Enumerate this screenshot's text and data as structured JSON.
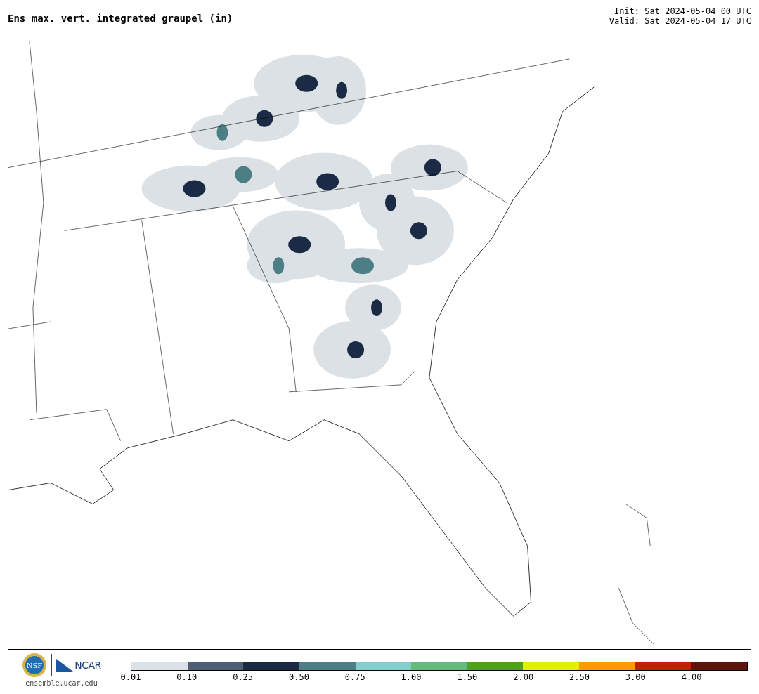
{
  "title": "Ens max. vert. integrated graupel (in)",
  "init": "Init: Sat 2024-05-04 00 UTC",
  "valid": "Valid: Sat 2024-05-04 17 UTC",
  "logos": {
    "nsf": "NSF",
    "ncar": "NCAR"
  },
  "site": "ensemble.ucar.edu",
  "legend": [
    {
      "label": "0.01",
      "color": "#dce1e5"
    },
    {
      "label": "0.10",
      "color": "#505e73"
    },
    {
      "label": "0.25",
      "color": "#1b2b45"
    },
    {
      "label": "0.50",
      "color": "#4b7e85"
    },
    {
      "label": "0.75",
      "color": "#83cfcb"
    },
    {
      "label": "1.00",
      "color": "#64bb7f"
    },
    {
      "label": "1.50",
      "color": "#4f9f21"
    },
    {
      "label": "2.00",
      "color": "#e0f000"
    },
    {
      "label": "2.50",
      "color": "#fb9d00"
    },
    {
      "label": "3.00",
      "color": "#c02200"
    },
    {
      "label": "4.00",
      "color": "#5c160b"
    }
  ]
}
